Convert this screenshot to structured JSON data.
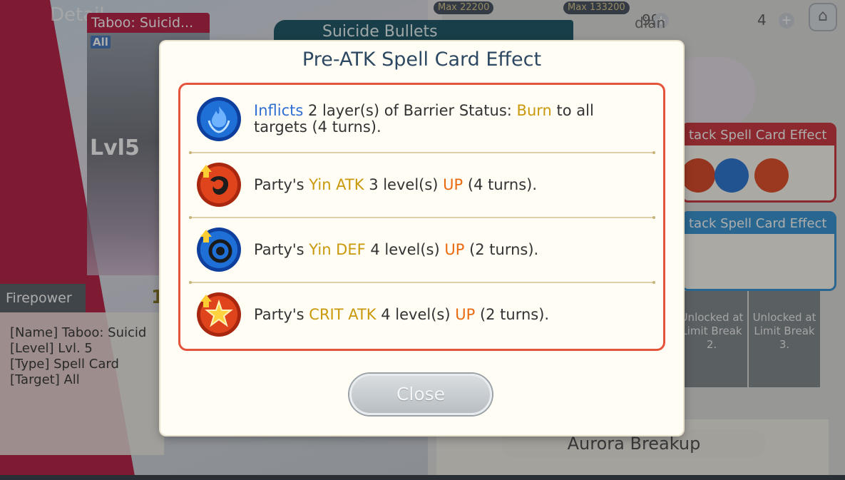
{
  "background": {
    "detail_label": "Detail",
    "card": {
      "title": "Taboo: Suicid...",
      "target_badge": "All",
      "level": "Lvl5"
    },
    "firepower_label": "Firepower",
    "firepower_value": "1",
    "info_lines": [
      "[Name] Taboo: Suicid",
      "[Level] Lvl. 5",
      "[Type] Spell Card",
      "[Target] All"
    ],
    "spell_banner": "Suicide Bullets",
    "hud": {
      "pill1": "Max 22200",
      "pill2": "Max 133200",
      "count1": "99",
      "count2": "4",
      "guardian": "dian"
    },
    "atk_panel_header": "tack Spell Card Effect",
    "def_panel_header": "tack Spell Card Effect",
    "locked_slots": [
      "Unlocked at Limit Break 2.",
      "Unlocked at Limit Break 3."
    ],
    "aurora_label": "Aurora Breakup"
  },
  "modal": {
    "title": "Pre-ATK Spell Card Effect",
    "effects": [
      {
        "icon": "burn-barrier-icon",
        "icon_color": "#1e6fd6",
        "parts": [
          {
            "text": "Inflicts",
            "style": "blue"
          },
          {
            "text": " 2 layer(s) of Barrier Status: ",
            "style": "plain"
          },
          {
            "text": "Burn",
            "style": "gold"
          },
          {
            "text": " to all targets (4 turns).",
            "style": "plain"
          }
        ]
      },
      {
        "icon": "yin-atk-up-icon",
        "icon_color": "#e0441c",
        "parts": [
          {
            "text": "Party's ",
            "style": "plain"
          },
          {
            "text": "Yin ATK",
            "style": "gold"
          },
          {
            "text": " 3 level(s) ",
            "style": "plain"
          },
          {
            "text": "UP",
            "style": "orange"
          },
          {
            "text": " (4 turns).",
            "style": "plain"
          }
        ]
      },
      {
        "icon": "yin-def-up-icon",
        "icon_color": "#1e6fd6",
        "parts": [
          {
            "text": "Party's ",
            "style": "plain"
          },
          {
            "text": "Yin DEF",
            "style": "gold"
          },
          {
            "text": " 4 level(s) ",
            "style": "plain"
          },
          {
            "text": "UP",
            "style": "orange"
          },
          {
            "text": " (2 turns).",
            "style": "plain"
          }
        ]
      },
      {
        "icon": "crit-atk-up-icon",
        "icon_color": "#e0441c",
        "parts": [
          {
            "text": "Party's ",
            "style": "plain"
          },
          {
            "text": "CRIT ATK",
            "style": "gold"
          },
          {
            "text": " 4 level(s) ",
            "style": "plain"
          },
          {
            "text": "UP",
            "style": "orange"
          },
          {
            "text": " (2 turns).",
            "style": "plain"
          }
        ]
      }
    ],
    "close_label": "Close"
  }
}
